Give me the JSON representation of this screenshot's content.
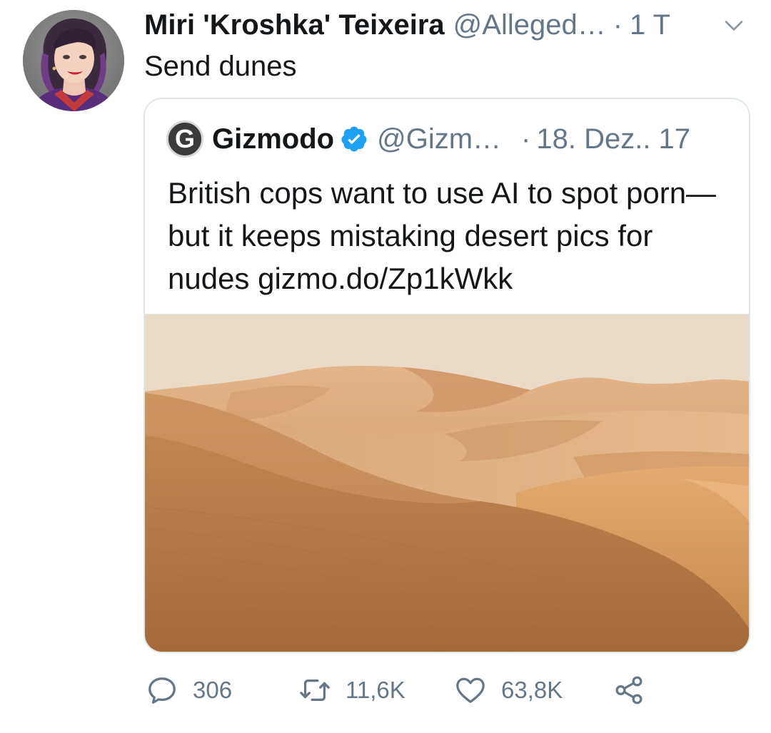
{
  "tweet": {
    "display_name": "Miri 'Kroshka' Teixeira",
    "handle": "@Alleged…",
    "separator": "·",
    "time": "1 T",
    "text": "Send dunes",
    "avatar_icon": "profile-photo"
  },
  "quoted_tweet": {
    "avatar_letter": "G",
    "display_name": "Gizmodo",
    "verified_icon": "verified-badge-icon",
    "handle": "@Gizm…",
    "separator": "·",
    "date": "18. Dez.. 17",
    "text": "British cops want to use AI to spot porn—but it keeps mistaking desert pics for nudes gizmo.do/Zp1kWkk",
    "image_icon": "desert-dunes-photo"
  },
  "actions": {
    "reply": {
      "icon": "reply-icon",
      "count": "306"
    },
    "retweet": {
      "icon": "retweet-icon",
      "count": "11,6K"
    },
    "like": {
      "icon": "heart-icon",
      "count": "63,8K"
    },
    "share": {
      "icon": "share-icon"
    }
  },
  "colors": {
    "text_primary": "#14171a",
    "text_secondary": "#657786",
    "verified_blue": "#1da1f2",
    "border": "#e1e8ed",
    "icon_gray": "#657786"
  }
}
